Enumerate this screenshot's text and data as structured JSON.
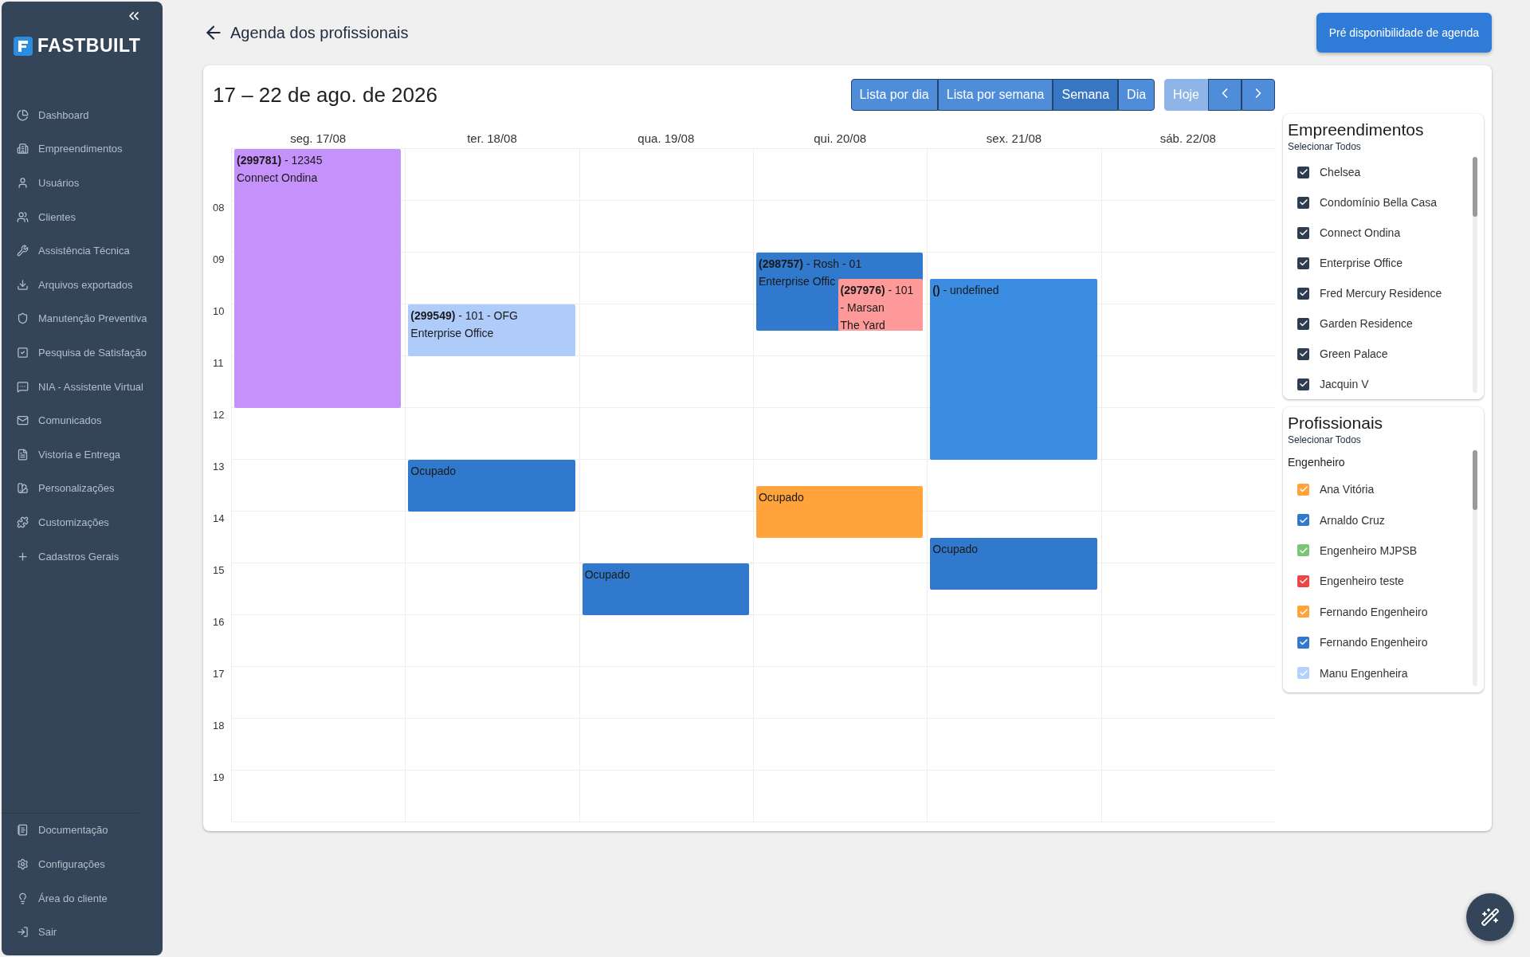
{
  "sidebar": {
    "logo": "FASTBUILT",
    "items": [
      {
        "label": "Dashboard"
      },
      {
        "label": "Empreendimentos"
      },
      {
        "label": "Usuários"
      },
      {
        "label": "Clientes"
      },
      {
        "label": "Assistência Técnica"
      },
      {
        "label": "Arquivos exportados"
      },
      {
        "label": "Manutenção Preventiva"
      },
      {
        "label": "Pesquisa de Satisfação"
      },
      {
        "label": "NIA - Assistente Virtual"
      },
      {
        "label": "Comunicados"
      },
      {
        "label": "Vistoria e Entrega"
      },
      {
        "label": "Personalizações"
      },
      {
        "label": "Customizações"
      },
      {
        "label": "Cadastros Gerais"
      }
    ],
    "bottom_items": [
      {
        "label": "Documentação"
      },
      {
        "label": "Configurações"
      },
      {
        "label": "Área do cliente"
      },
      {
        "label": "Sair"
      }
    ]
  },
  "page_title": "Agenda dos profissionais",
  "action_button": "Pré disponibilidade de agenda",
  "calendar": {
    "range_title": "17 – 22 de ago. de 2026",
    "views": [
      {
        "label": "Lista por dia",
        "selected": false
      },
      {
        "label": "Lista por semana",
        "selected": false
      },
      {
        "label": "Semana",
        "selected": true
      },
      {
        "label": "Dia",
        "selected": false
      }
    ],
    "today_button": {
      "label": "Hoje",
      "disabled": true
    },
    "hour_labels": [
      "08",
      "09",
      "10",
      "11",
      "12",
      "13",
      "14",
      "15",
      "16",
      "17",
      "18",
      "19"
    ],
    "days": [
      {
        "label": "seg. 17/08",
        "events": [
          {
            "color": "#c592fb",
            "lines": [
              "**(299781)** - 12345",
              "Connect Ondina"
            ]
          }
        ]
      },
      {
        "label": "ter. 18/08",
        "events": [
          {
            "color": "#aecbfa",
            "lines": [
              "**(299549)** - 101 - OFG",
              "Enterprise Office"
            ]
          },
          {
            "color": "#3079cc",
            "lines": [
              "Ocupado"
            ]
          }
        ]
      },
      {
        "label": "qua. 19/08",
        "events": [
          {
            "color": "#3079cc",
            "lines": [
              "Ocupado"
            ]
          }
        ]
      },
      {
        "label": "qui. 20/08",
        "events": [
          {
            "color": "#3079cc",
            "lines": [
              "**(298757)** - Rosh - 01",
              "Enterprise Offic"
            ]
          },
          {
            "color": "#ff9a9a",
            "lines": [
              "**(297976)** - 101",
              "- Marsan",
              "The Yard"
            ]
          },
          {
            "color": "#ffa33a",
            "lines": [
              "Ocupado"
            ]
          }
        ]
      },
      {
        "label": "sex. 21/08",
        "events": [
          {
            "color": "#3a8de0",
            "lines": [
              "**()** - undefined"
            ]
          },
          {
            "color": "#3079cc",
            "lines": [
              "Ocupado"
            ]
          }
        ]
      },
      {
        "label": "sáb. 22/08"
      }
    ]
  },
  "filters": [
    {
      "title": "Empreendimentos",
      "select_all": "Selecionar Todos",
      "items": [
        {
          "label": "Chelsea",
          "checked": true,
          "color": "#2e3c50"
        },
        {
          "label": "Condomínio Bella Casa",
          "checked": true,
          "color": "#2e3c50"
        },
        {
          "label": "Connect Ondina",
          "checked": true,
          "color": "#2e3c50"
        },
        {
          "label": "Enterprise Office",
          "checked": true,
          "color": "#2e3c50"
        },
        {
          "label": "Fred Mercury Residence",
          "checked": true,
          "color": "#2e3c50"
        },
        {
          "label": "Garden Residence",
          "checked": true,
          "color": "#2e3c50"
        },
        {
          "label": "Green Palace",
          "checked": true,
          "color": "#2e3c50"
        },
        {
          "label": "Jacquin V",
          "checked": true,
          "color": "#2e3c50"
        }
      ]
    },
    {
      "title": "Profissionais",
      "select_all": "Selecionar Todos",
      "group": "Engenheiro",
      "items": [
        {
          "label": "Ana Vitória",
          "checked": true,
          "color": "#ffa33a"
        },
        {
          "label": "Arnaldo Cruz",
          "checked": true,
          "color": "#3079cc"
        },
        {
          "label": "Engenheiro MJPSB",
          "checked": true,
          "color": "#7cc576"
        },
        {
          "label": "Engenheiro teste",
          "checked": true,
          "color": "#ef4444"
        },
        {
          "label": "Fernando Engenheiro",
          "checked": true,
          "color": "#ffa33a"
        },
        {
          "label": "Fernando Engenheiro",
          "checked": true,
          "color": "#3079cc"
        },
        {
          "label": "Manu Engenheira",
          "checked": true,
          "color": "#b5d1fb"
        }
      ]
    }
  ]
}
